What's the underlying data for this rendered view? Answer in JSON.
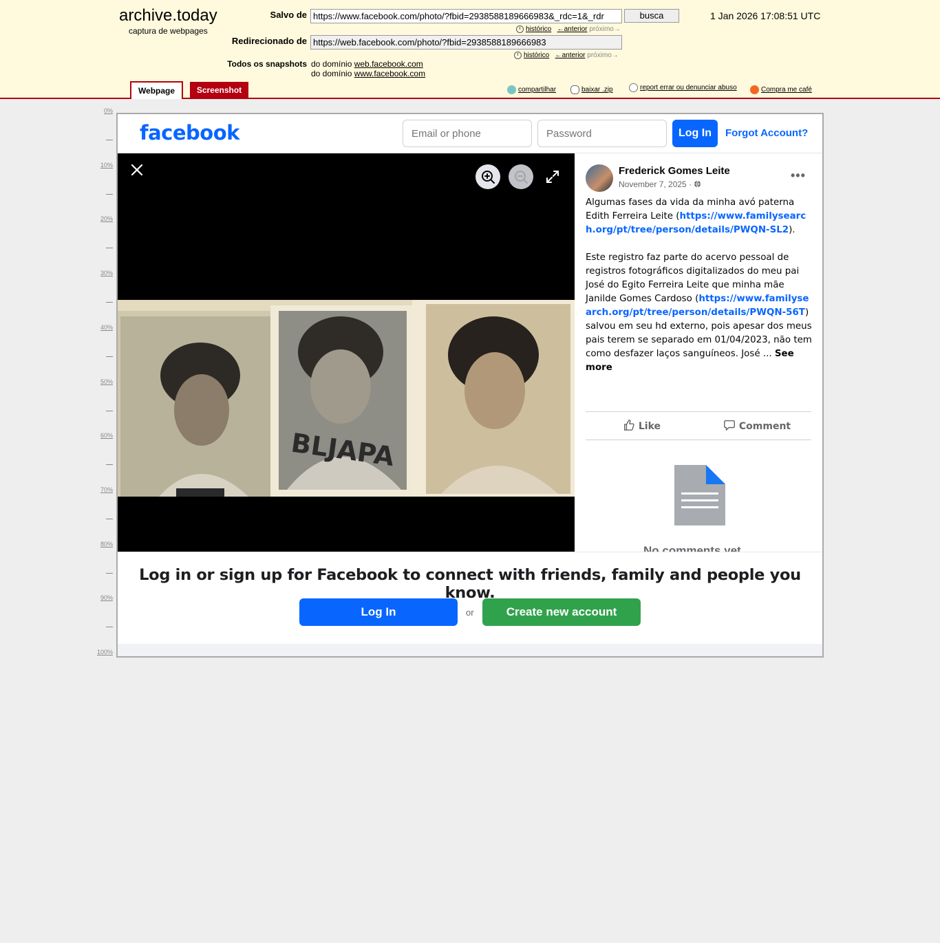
{
  "archive": {
    "title": "archive.today",
    "subtitle": "captura de webpages",
    "saved_from_label": "Salvo de",
    "saved_from_url": "https://www.facebook.com/photo/?fbid=2938588189666983&_rdc=1&_rdr",
    "search_button": "busca",
    "timestamp": "1 Jan 2026 17:08:51 UTC",
    "redirected_label": "Redirecionado de",
    "redirected_url": "https://web.facebook.com/photo/?fbid=2938588189666983",
    "history_link": "histórico",
    "previous_link": "←anterior",
    "next_link": "próximo→",
    "all_snapshots_label": "Todos os snapshots",
    "domain_prefix": "do domínio",
    "domain_1": "web.facebook.com",
    "domain_2": "www.facebook.com",
    "tab_webpage": "Webpage",
    "tab_screenshot": "Screenshot",
    "share": "compartilhar",
    "download": "baixar .zip",
    "report": "report errar ou denunciar abuso",
    "coffee": "Compra me café",
    "ruler": [
      "0%",
      "10%",
      "20%",
      "30%",
      "40%",
      "50%",
      "60%",
      "70%",
      "80%",
      "90%",
      "100%"
    ],
    "colors": {
      "header_bg": "#fff9dd",
      "accent_red": "#b40010"
    }
  },
  "facebook": {
    "logo": "facebook",
    "email_placeholder": "Email or phone",
    "password_placeholder": "Password",
    "login_button": "Log In",
    "forgot_link": "Forgot Account?",
    "post": {
      "author": "Frederick Gomes Leite",
      "date": "November 7, 2025",
      "date_sep": " · ",
      "more": "•••",
      "text1_a": "Algumas fases da vida da minha avó paterna Edith Ferreira Leite (",
      "link1": "https://www.familysearch.org/pt/tree/person/details/PWQN-SL2",
      "text1_b": ").",
      "text2_a": "Este registro faz parte do acervo pessoal de registros fotográficos digitalizados do meu pai José do Egito Ferreira Leite que minha mãe Janilde Gomes Cardoso (",
      "link2": "https://www.familysearch.org/pt/tree/person/details/PWQN-56T",
      "text2_b": ") salvou em seu hd externo, pois apesar dos meus pais terem se separado em 01/04/2023, não tem como desfazer laços sanguíneos. José ... ",
      "see_more": "See more",
      "like": "Like",
      "comment": "Comment",
      "no_comments": "No comments yet"
    },
    "photo_card_text": "BLJAPA",
    "signup": {
      "title": "Log in or sign up for Facebook to connect with friends, family and people you know.",
      "login": "Log In",
      "or": "or",
      "create": "Create new account"
    },
    "colors": {
      "brand_blue": "#0866ff",
      "create_green": "#31a24c"
    }
  }
}
